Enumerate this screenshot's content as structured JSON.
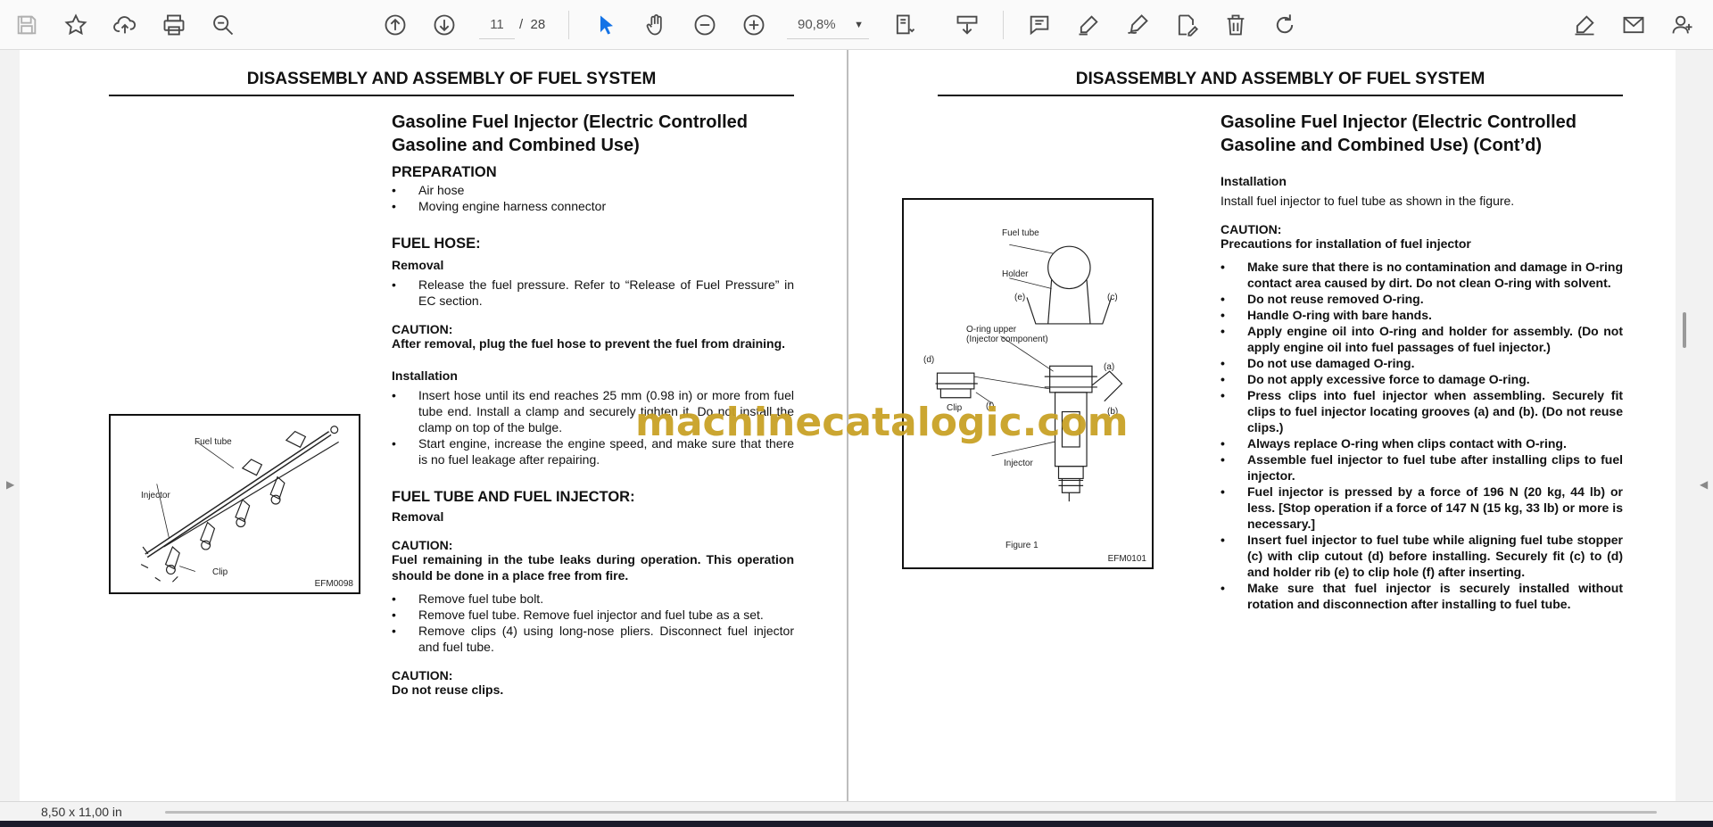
{
  "toolbar": {
    "icons": [
      "save-icon",
      "bookmark-star-icon",
      "upload-cloud-icon",
      "print-icon",
      "zoom-search-icon",
      "page-up-icon",
      "page-down-icon",
      "zoom-out-icon",
      "zoom-in-icon",
      "select-cursor-icon",
      "hand-icon",
      "fit-page-icon",
      "scroll-mode-icon",
      "comment-icon",
      "highlight-pen-icon",
      "draw-icon",
      "stamp-icon",
      "delete-icon",
      "rotate-icon",
      "fill-sign-icon",
      "mail-icon",
      "add-user-icon"
    ],
    "current_page": "11",
    "page_separator": "/",
    "total_pages": "28",
    "zoom": "90,8%"
  },
  "status": {
    "page_size": "8,50 x 11,00 in"
  },
  "watermark": "machinecatalogic.com",
  "left_page": {
    "header": "DISASSEMBLY AND ASSEMBLY OF FUEL SYSTEM",
    "title": "Gasoline Fuel Injector (Electric Controlled Gasoline and Combined Use)",
    "preparation": {
      "heading": "PREPARATION",
      "items": [
        "Air hose",
        "Moving engine harness connector"
      ]
    },
    "fuel_hose": {
      "heading": "FUEL HOSE:",
      "removal_heading": "Removal",
      "removal_items": [
        "Release the fuel pressure. Refer to “Release of Fuel Pressure” in EC section."
      ],
      "caution_label": "CAUTION:",
      "caution_text": "After removal, plug the fuel hose to prevent the fuel from draining.",
      "installation_heading": "Installation",
      "installation_items": [
        "Insert hose until its end reaches 25 mm (0.98 in) or more from fuel tube end. Install a clamp and securely tighten it. Do not install the clamp on top of the bulge.",
        "Start engine, increase the engine speed, and make sure that there is no fuel leakage after repairing."
      ]
    },
    "fuel_tube": {
      "heading": "FUEL TUBE AND FUEL INJECTOR:",
      "removal_heading": "Removal",
      "caution_label": "CAUTION:",
      "caution_text": "Fuel remaining in the tube leaks during operation. This operation should be done in a place free from fire.",
      "items": [
        "Remove fuel tube bolt.",
        "Remove fuel tube. Remove fuel injector and fuel tube as a set.",
        "Remove clips (4) using long-nose pliers. Disconnect fuel injector and fuel tube."
      ],
      "caution2_label": "CAUTION:",
      "caution2_text": "Do not reuse clips."
    },
    "figure": {
      "code": "EFM0098",
      "labels": {
        "fuel_tube": "Fuel tube",
        "injector": "Injector",
        "clip": "Clip"
      }
    }
  },
  "right_page": {
    "header": "DISASSEMBLY AND ASSEMBLY OF FUEL SYSTEM",
    "title": "Gasoline Fuel Injector (Electric Controlled Gasoline and Combined Use) (Cont’d)",
    "installation_heading": "Installation",
    "installation_text": "Install fuel injector to fuel tube as shown in the figure.",
    "caution_label": "CAUTION:",
    "caution_subheading": "Precautions for installation of fuel injector",
    "items": [
      "Make sure that there is no contamination and damage in O-ring contact area caused by dirt. Do not clean O-ring with solvent.",
      "Do not reuse removed O-ring.",
      "Handle O-ring with bare hands.",
      "Apply engine oil into O-ring and holder for assembly. (Do not apply engine oil into fuel passages of fuel injector.)",
      "Do not use damaged O-ring.",
      "Do not apply excessive force to damage O-ring.",
      "Press clips into fuel injector when assembling. Securely fit clips to fuel injector locating grooves (a) and (b). (Do not reuse clips.)",
      "Always replace O-ring when clips contact with O-ring.",
      "Assemble fuel injector to fuel tube after installing clips to fuel injector.",
      "Fuel injector is pressed by a force of 196 N (20 kg, 44 lb) or less. [Stop operation if a force of 147 N (15 kg, 33 lb) or more is necessary.]",
      "Insert fuel injector to fuel tube while aligning fuel tube stopper (c) with clip cutout (d) before installing. Securely fit (c) to (d) and holder rib (e) to clip hole (f) after inserting.",
      "Make sure that fuel injector is securely installed without rotation and disconnection after installing to fuel tube."
    ],
    "figure": {
      "code": "EFM0101",
      "caption": "Figure 1",
      "labels": {
        "fuel_tube": "Fuel tube",
        "holder": "Holder",
        "e": "(e)",
        "c": "(c)",
        "oring1": "O-ring upper",
        "oring2": "(Injector component)",
        "a": "(a)",
        "b": "(b)",
        "d": "(d)",
        "clip": "Clip",
        "f": "(f)",
        "injector": "Injector"
      }
    }
  }
}
